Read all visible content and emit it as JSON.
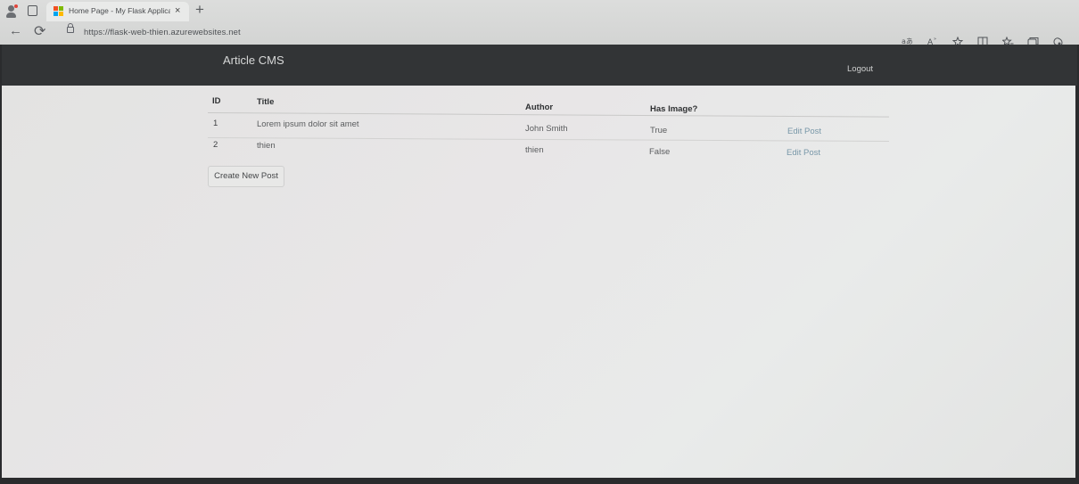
{
  "browser": {
    "tab_title": "Home Page - My Flask Applicati",
    "tab_close": "×",
    "new_tab": "+",
    "url": "https://flask-web-thien.azurewebsites.net",
    "back_glyph": "←",
    "refresh_glyph": "⟳",
    "favicon_colors": [
      "#f25022",
      "#7fba00",
      "#00a4ef",
      "#ffb900"
    ],
    "toolbar_icons": [
      "read-aloud-icon",
      "text-size-icon",
      "favorite-star-icon",
      "split-screen-icon",
      "favorites-icon",
      "collections-icon",
      "extensions-icon"
    ]
  },
  "navbar": {
    "brand": "Article CMS",
    "logout": "Logout"
  },
  "table": {
    "headers": {
      "id": "ID",
      "title": "Title",
      "author": "Author",
      "has_image": "Has Image?"
    },
    "rows": [
      {
        "id": "1",
        "title": "Lorem ipsum dolor sit amet",
        "author": "John Smith",
        "has_image": "True",
        "action": "Edit Post"
      },
      {
        "id": "2",
        "title": "thien",
        "author": "thien",
        "has_image": "False",
        "action": "Edit Post"
      }
    ]
  },
  "create_button": "Create New Post"
}
